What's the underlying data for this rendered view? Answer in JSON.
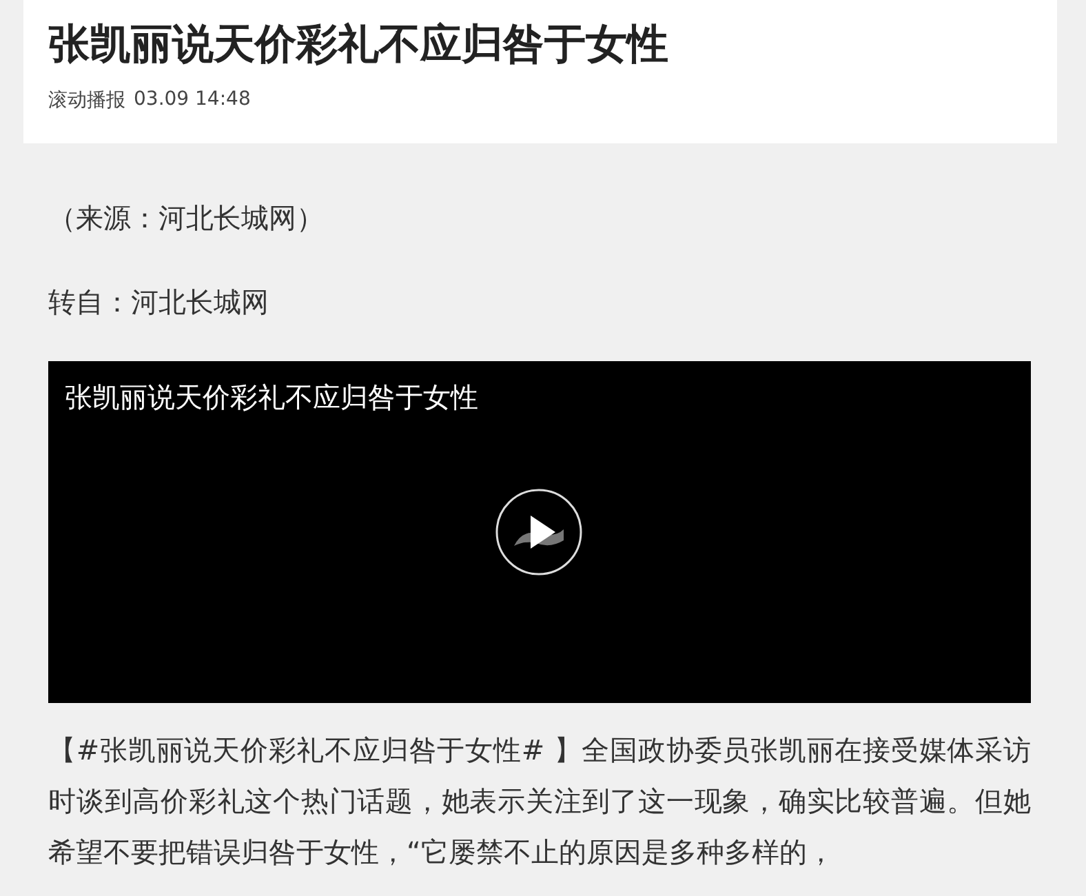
{
  "article": {
    "title": "张凯丽说天价彩礼不应归咎于女性",
    "source_channel": "滚动播报",
    "time": "03.09 14:48"
  },
  "body": [
    {
      "kind": "text",
      "text": "（来源：河北长城网）"
    },
    {
      "kind": "text",
      "text": "转自：河北长城网"
    },
    {
      "kind": "video",
      "title": "张凯丽说天价彩礼不应归咎于女性"
    },
    {
      "kind": "text",
      "text": "【#张凯丽说天价彩礼不应归咎于女性# 】全国政协委员张凯丽在接受媒体采访时谈到高价彩礼这个热门话题，她表示关注到了这一现象，确实比较普遍。但她希望不要把错误归咎于女性，“它屡禁不止的原因是多种多样的，"
    }
  ]
}
